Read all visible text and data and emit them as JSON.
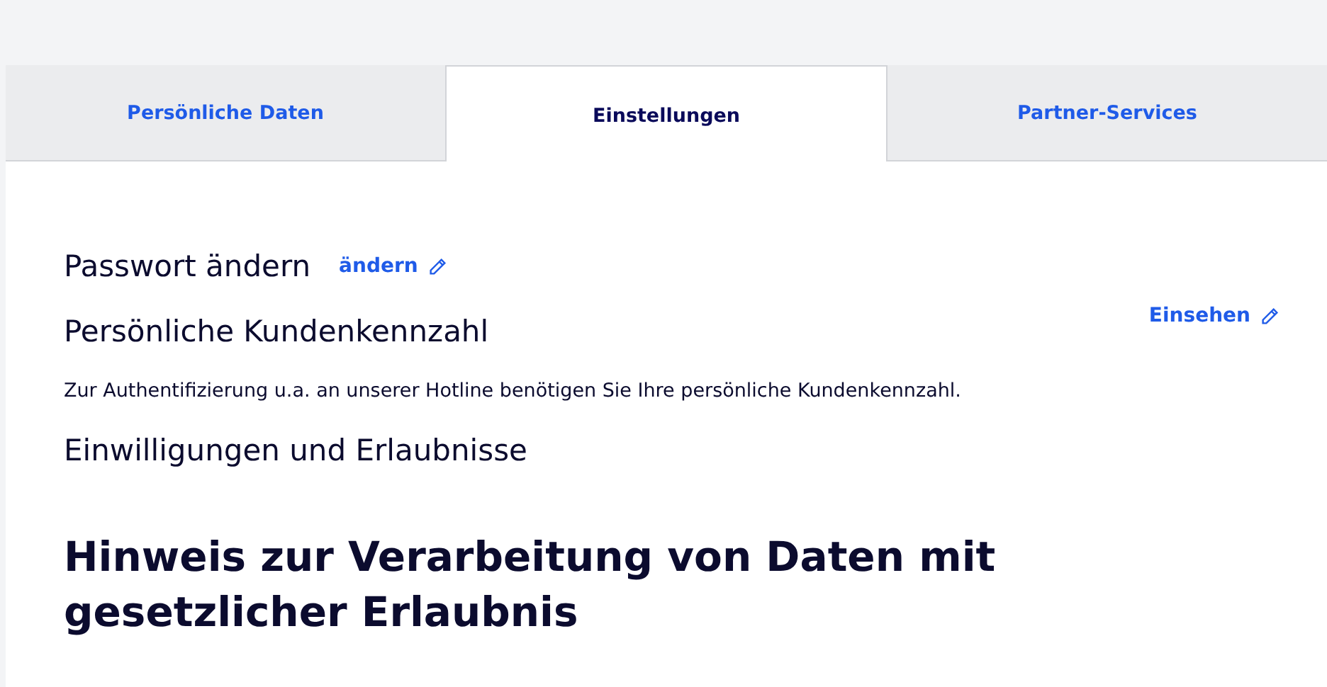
{
  "tabs": [
    {
      "label": "Persönliche Daten",
      "selected": false
    },
    {
      "label": "Einstellungen",
      "selected": true
    },
    {
      "label": "Partner-Services",
      "selected": false
    }
  ],
  "password": {
    "title": "Passwort ändern",
    "link": "ändern"
  },
  "customer_number": {
    "title": "Persönliche Kundenkennzahl",
    "link": "Einsehen",
    "description": "Zur Authentifizierung u.a. an unserer Hotline benötigen Sie Ihre persönliche Kundenkennzahl."
  },
  "consents": {
    "title": "Einwilligungen und Erlaubnisse"
  },
  "notice": {
    "heading": "Hinweis zur Verarbeitung von Daten mit gesetzlicher Erlaubnis"
  }
}
